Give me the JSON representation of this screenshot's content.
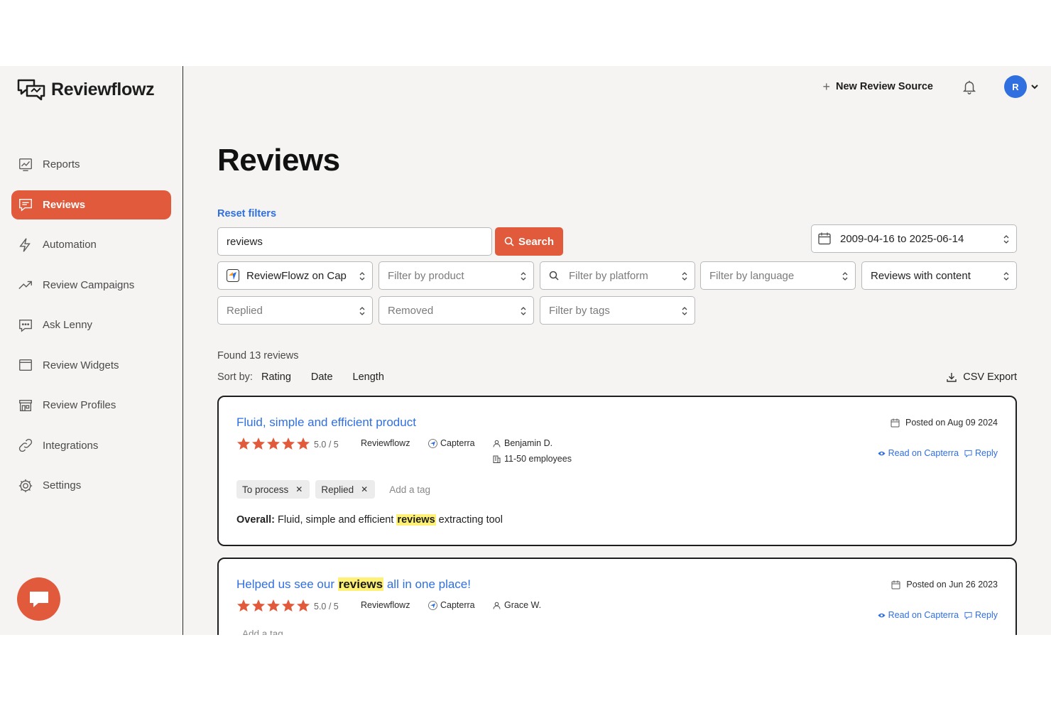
{
  "app": {
    "name": "Reviewflowz"
  },
  "sidebar": {
    "items": [
      {
        "label": "Reports",
        "icon": "reports-icon"
      },
      {
        "label": "Reviews",
        "icon": "chat-icon",
        "active": true
      },
      {
        "label": "Automation",
        "icon": "lightning-icon"
      },
      {
        "label": "Review Campaigns",
        "icon": "trend-icon"
      },
      {
        "label": "Ask Lenny",
        "icon": "message-icon"
      },
      {
        "label": "Review Widgets",
        "icon": "window-icon"
      },
      {
        "label": "Review Profiles",
        "icon": "store-icon"
      },
      {
        "label": "Integrations",
        "icon": "link-icon"
      },
      {
        "label": "Settings",
        "icon": "gear-icon"
      }
    ]
  },
  "header": {
    "new_source_label": "New Review Source",
    "avatar_initial": "R"
  },
  "page": {
    "title": "Reviews",
    "reset_filters": "Reset filters"
  },
  "filters": {
    "search_value": "reviews",
    "search_button": "Search",
    "date_range": "2009-04-16 to 2025-06-14",
    "profile": "ReviewFlowz on Cap",
    "product_placeholder": "Filter by product",
    "platform_placeholder": "Filter by platform",
    "language_placeholder": "Filter by language",
    "content": "Reviews with content",
    "replied_placeholder": "Replied",
    "removed_placeholder": "Removed",
    "tags_placeholder": "Filter by tags"
  },
  "results": {
    "found_text": "Found 13 reviews",
    "sort_label": "Sort by:",
    "sort_options": [
      "Rating",
      "Date",
      "Length"
    ],
    "csv_export": "CSV Export"
  },
  "reviews": [
    {
      "title": "Fluid, simple and efficient product",
      "rating": 5,
      "rating_text": "5.0 / 5",
      "product": "Reviewflowz",
      "platform": "Capterra",
      "author": "Benjamin D.",
      "company_size": "11-50 employees",
      "posted": "Posted on Aug 09 2024",
      "read_link": "Read on Capterra",
      "reply_link": "Reply",
      "tags": [
        "To process",
        "Replied"
      ],
      "add_tag": "Add a tag",
      "overall_label": "Overall:",
      "overall_before": "Fluid, simple and efficient",
      "overall_highlight": "reviews",
      "overall_after": "extracting tool"
    },
    {
      "title_before": "Helped us see our",
      "title_highlight": "reviews",
      "title_after": "all in one place!",
      "rating": 5,
      "rating_text": "5.0 / 5",
      "product": "Reviewflowz",
      "platform": "Capterra",
      "author": "Grace W.",
      "posted": "Posted on Jun 26 2023",
      "read_link": "Read on Capterra",
      "reply_link": "Reply",
      "add_tag": "Add a tag"
    }
  ],
  "colors": {
    "accent": "#e05a3b",
    "link": "#2f6fe0",
    "highlight": "#fff176",
    "star": "#e05a3b"
  }
}
